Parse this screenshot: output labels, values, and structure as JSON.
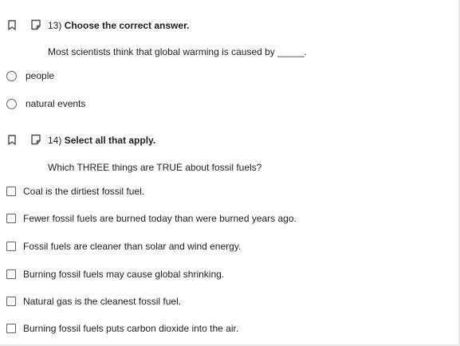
{
  "questions": [
    {
      "number": "13)",
      "instruction": "Choose the correct answer.",
      "text": "Most scientists think that global warming is caused by _____.",
      "type": "radio",
      "options": [
        "people",
        "natural events"
      ]
    },
    {
      "number": "14)",
      "instruction": "Select all that apply.",
      "text": "Which THREE things  are TRUE about fossil fuels?",
      "type": "checkbox",
      "options": [
        "Coal is the dirtiest fossil fuel.",
        "Fewer fossil fuels are burned today than were burned years ago.",
        "Fossil fuels are cleaner than solar and wind energy.",
        "Burning fossil fuels may cause global shrinking.",
        "Natural gas is the cleanest fossil fuel.",
        "Burning fossil fuels puts carbon dioxide into the air."
      ]
    }
  ],
  "icons": {
    "bookmark": "bookmark-icon",
    "note": "note-icon"
  },
  "colors": {
    "text": "#202124",
    "control_border": "#5f6368",
    "icon": "#4a4a4a"
  }
}
